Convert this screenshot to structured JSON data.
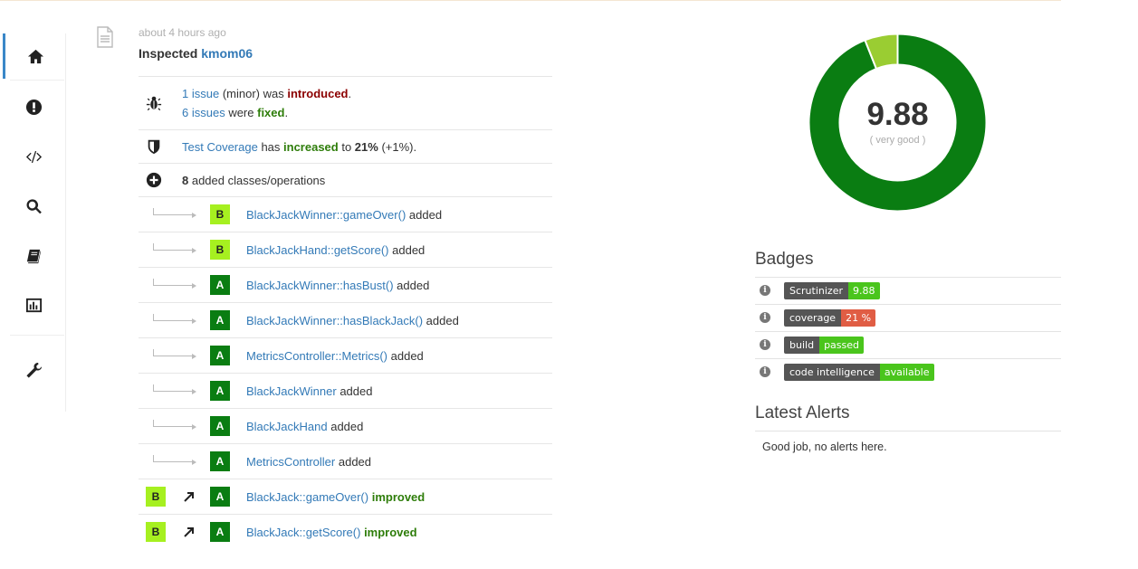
{
  "sidebar": {
    "items": [
      {
        "icon": "home-icon"
      },
      {
        "icon": "issues-icon"
      },
      {
        "icon": "code-icon"
      },
      {
        "icon": "search-icon"
      },
      {
        "icon": "book-icon"
      },
      {
        "icon": "chart-icon"
      },
      {
        "icon": "wrench-icon"
      }
    ]
  },
  "event": {
    "time": "about 4 hours ago",
    "inspected_label": "Inspected",
    "commit": "kmom06"
  },
  "summary": {
    "issues_new_link": "1 issue",
    "issues_new_mid": " (minor) was ",
    "issues_new_status": "introduced",
    "issues_new_end": ".",
    "issues_fixed_link": "6 issues",
    "issues_fixed_mid": " were ",
    "issues_fixed_status": "fixed",
    "issues_fixed_end": ".",
    "coverage_link": "Test Coverage",
    "coverage_mid": " has ",
    "coverage_status": "increased",
    "coverage_to": " to ",
    "coverage_value": "21%",
    "coverage_delta": " (+1%).",
    "added_count": "8",
    "added_label": " added classes/operations"
  },
  "added_items": [
    {
      "grade": "B",
      "name": "BlackJackWinner::gameOver()",
      "suffix": " added"
    },
    {
      "grade": "B",
      "name": "BlackJackHand::getScore()",
      "suffix": " added"
    },
    {
      "grade": "A",
      "name": "BlackJackWinner::hasBust()",
      "suffix": " added"
    },
    {
      "grade": "A",
      "name": "BlackJackWinner::hasBlackJack()",
      "suffix": " added"
    },
    {
      "grade": "A",
      "name": "MetricsController::Metrics()",
      "suffix": " added"
    },
    {
      "grade": "A",
      "name": "BlackJackWinner",
      "suffix": " added"
    },
    {
      "grade": "A",
      "name": "BlackJackHand",
      "suffix": " added"
    },
    {
      "grade": "A",
      "name": "MetricsController",
      "suffix": " added"
    }
  ],
  "improved_items": [
    {
      "from": "B",
      "to": "A",
      "name": "BlackJack::gameOver()",
      "suffix": "improved"
    },
    {
      "from": "B",
      "to": "A",
      "name": "BlackJack::getScore()",
      "suffix": "improved"
    }
  ],
  "score": {
    "value": "9.88",
    "label": "( very good )",
    "fraction": 0.94,
    "color_main": "#0a7d12",
    "color_rest": "#9acd32"
  },
  "badges": {
    "title": "Badges",
    "items": [
      {
        "key": "Scrutinizer",
        "value": "9.88",
        "color": "#4ac51c"
      },
      {
        "key": "coverage",
        "value": "21 %",
        "color": "#e05d44"
      },
      {
        "key": "build",
        "value": "passed",
        "color": "#4ac51c"
      },
      {
        "key": "code intelligence",
        "value": "available",
        "color": "#4ac51c"
      }
    ]
  },
  "alerts": {
    "title": "Latest Alerts",
    "message": "Good job, no alerts here."
  }
}
